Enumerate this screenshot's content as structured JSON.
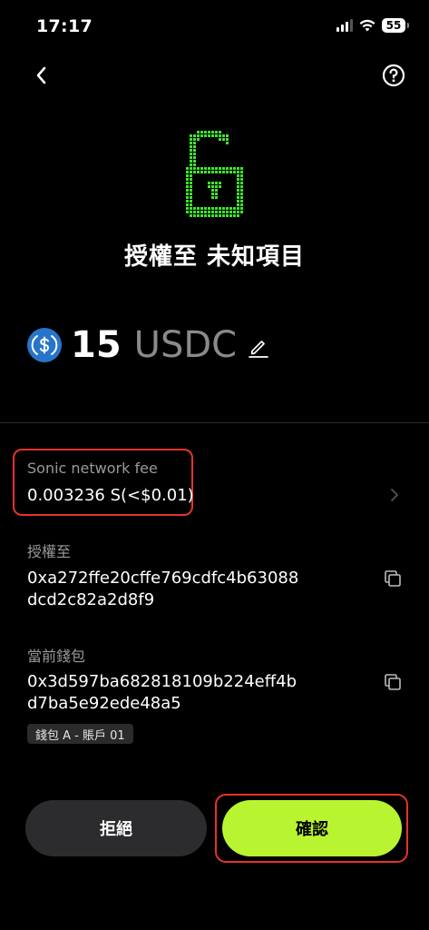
{
  "status_bar": {
    "time": "17:17",
    "battery": "55"
  },
  "header": {
    "title": "授權至 未知項目"
  },
  "amount": {
    "value": "15",
    "token": "USDC"
  },
  "fee": {
    "label": "Sonic network fee",
    "value": "0.003236 S(<$0.01)"
  },
  "authorize_to": {
    "label": "授權至",
    "address_line1": "0xa272ffe20cffe769cdfc4b63088",
    "address_line2": "dcd2c82a2d8f9"
  },
  "current_wallet": {
    "label": "當前錢包",
    "address_line1": "0x3d597ba682818109b224eff4b",
    "address_line2": "d7ba5e92ede48a5",
    "badge": "錢包 A - 賬戶 01"
  },
  "actions": {
    "reject_label": "拒絕",
    "confirm_label": "確認"
  },
  "colors": {
    "accent": "#b8f530",
    "lock": "#39e62b",
    "usdc": "#2775ca",
    "highlight": "#e5332a"
  }
}
